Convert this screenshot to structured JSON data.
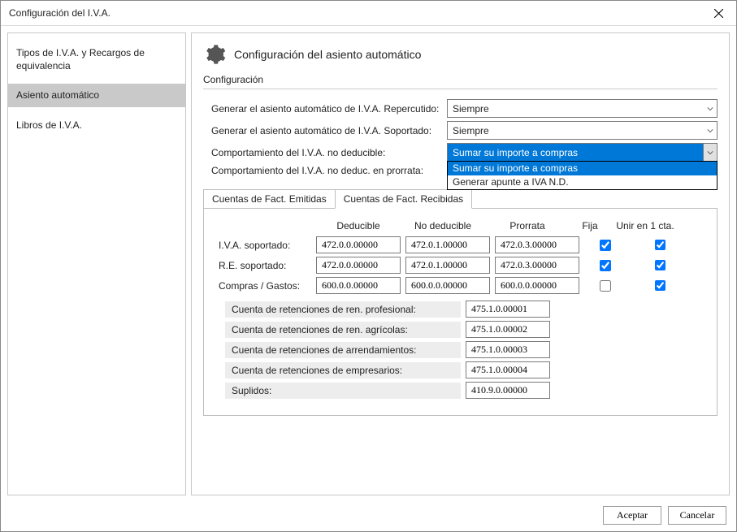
{
  "window": {
    "title": "Configuración del I.V.A."
  },
  "sidebar": {
    "items": [
      {
        "label": "Tipos de I.V.A. y Recargos de equivalencia",
        "selected": false
      },
      {
        "label": "Asiento automático",
        "selected": true
      },
      {
        "label": "Libros de I.V.A.",
        "selected": false
      }
    ]
  },
  "section": {
    "title": "Configuración del asiento automático",
    "group_label": "Configuración"
  },
  "form": {
    "rows": [
      {
        "label": "Generar el asiento automático de I.V.A. Repercutido:",
        "value": "Siempre"
      },
      {
        "label": "Generar el asiento automático de I.V.A. Soportado:",
        "value": "Siempre"
      },
      {
        "label": "Comportamiento del I.V.A. no deducible:",
        "value": "Sumar su importe a compras",
        "open": true
      },
      {
        "label": "Comportamiento del I.V.A. no deduc. en prorrata:",
        "value": ""
      }
    ],
    "dropdown_options": [
      "Sumar su importe a compras",
      "Generar apunte a IVA N.D."
    ]
  },
  "tabs": {
    "items": [
      {
        "label": "Cuentas de Fact. Emitidas",
        "active": false
      },
      {
        "label": "Cuentas de Fact. Recibidas",
        "active": true
      }
    ]
  },
  "table": {
    "headers": {
      "col1": "Deducible",
      "col2": "No deducible",
      "col3": "Prorrata",
      "col4": "Fija",
      "col5": "Unir en 1 cta."
    },
    "rows": [
      {
        "label": "I.V.A. soportado:",
        "c1": "472.0.0.00000",
        "c2": "472.0.1.00000",
        "c3": "472.0.3.00000",
        "fija": true,
        "unir": true
      },
      {
        "label": "R.E. soportado:",
        "c1": "472.0.0.00000",
        "c2": "472.0.1.00000",
        "c3": "472.0.3.00000",
        "fija": true,
        "unir": true
      },
      {
        "label": "Compras / Gastos:",
        "c1": "600.0.0.00000",
        "c2": "600.0.0.00000",
        "c3": "600.0.0.00000",
        "fija": false,
        "unir": true
      }
    ]
  },
  "retenciones": [
    {
      "label": "Cuenta de retenciones de ren. profesional:",
      "value": "475.1.0.00001"
    },
    {
      "label": "Cuenta de retenciones de ren. agrícolas:",
      "value": "475.1.0.00002"
    },
    {
      "label": "Cuenta de retenciones de arrendamientos:",
      "value": "475.1.0.00003"
    },
    {
      "label": "Cuenta de retenciones de empresarios:",
      "value": "475.1.0.00004"
    },
    {
      "label": "Suplidos:",
      "value": "410.9.0.00000"
    }
  ],
  "footer": {
    "ok": "Aceptar",
    "cancel": "Cancelar"
  }
}
